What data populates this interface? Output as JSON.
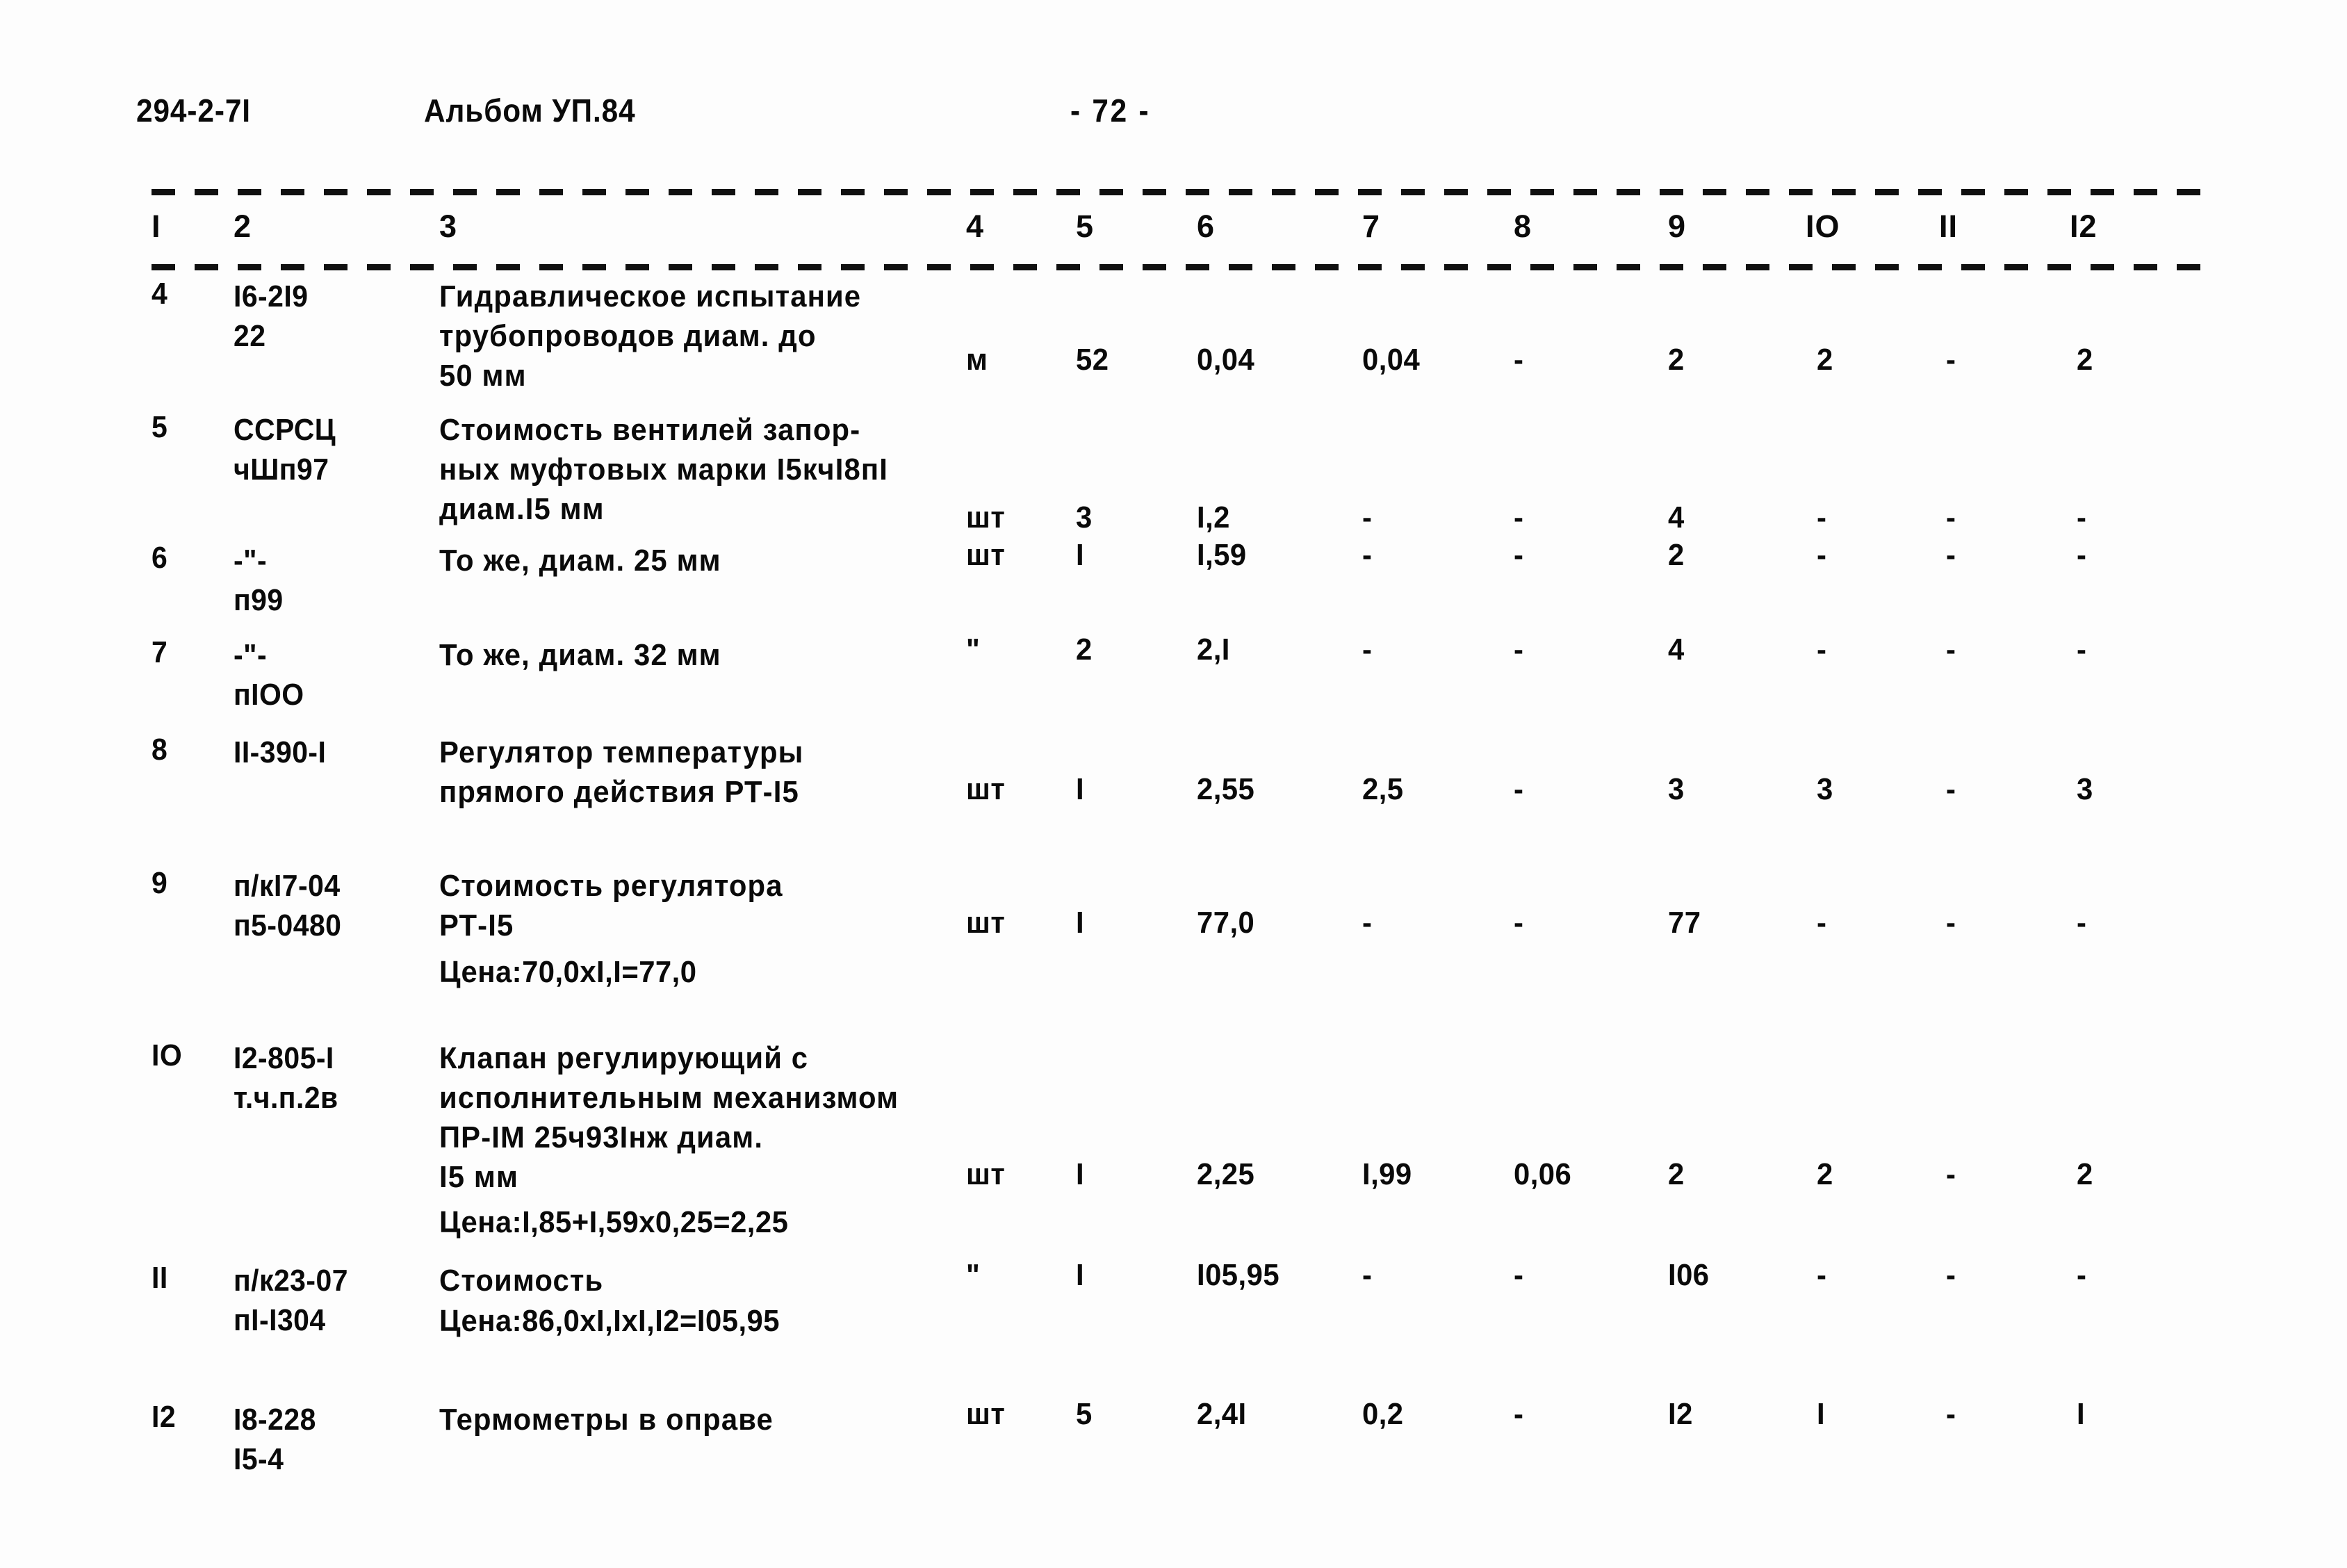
{
  "header": {
    "doc_code": "294-2-7I",
    "album": "Альбом УП.84",
    "page_marker": "- 72 -"
  },
  "table": {
    "column_headers": [
      "I",
      "2",
      "3",
      "4",
      "5",
      "6",
      "7",
      "8",
      "9",
      "IO",
      "II",
      "I2"
    ],
    "rows": [
      {
        "c1": "4",
        "c2": "I6-2I9\n22",
        "c3": "Гидравлическое испытание\nтрубопроводов диам. до\n50 мм",
        "c4": "м",
        "c5": "52",
        "c6": "0,04",
        "c7": "0,04",
        "c8": "-",
        "c9": "2",
        "c10": "2",
        "c11": "-",
        "c12": "2",
        "note": ""
      },
      {
        "c1": "5",
        "c2": "ССРСЦ\nчШп97",
        "c3": "Стоимость вентилей запор-\nных муфтовых марки I5кчI8пI\nдиам.I5 мм",
        "c4": "шт",
        "c5": "3",
        "c6": "I,2",
        "c7": "-",
        "c8": "-",
        "c9": "4",
        "c10": "-",
        "c11": "-",
        "c12": "-",
        "note": ""
      },
      {
        "c1": "6",
        "c2": "-\"-\nп99",
        "c3": "То же, диам. 25 мм",
        "c4": "шт",
        "c5": "I",
        "c6": "I,59",
        "c7": "-",
        "c8": "-",
        "c9": "2",
        "c10": "-",
        "c11": "-",
        "c12": "-",
        "note": ""
      },
      {
        "c1": "7",
        "c2": "-\"-\nпIOO",
        "c3": "То же, диам. 32 мм",
        "c4": "\"",
        "c5": "2",
        "c6": "2,I",
        "c7": "-",
        "c8": "-",
        "c9": "4",
        "c10": "-",
        "c11": "-",
        "c12": "-",
        "note": ""
      },
      {
        "c1": "8",
        "c2": "II-390-I",
        "c3": "Регулятор температуры\nпрямого действия РТ-I5",
        "c4": "шт",
        "c5": "I",
        "c6": "2,55",
        "c7": "2,5",
        "c8": "-",
        "c9": "3",
        "c10": "3",
        "c11": "-",
        "c12": "3",
        "note": ""
      },
      {
        "c1": "9",
        "c2": "п/кI7-04\nп5-0480",
        "c3": "Стоимость регулятора\nРТ-I5",
        "c4": "шт",
        "c5": "I",
        "c6": "77,0",
        "c7": "-",
        "c8": "-",
        "c9": "77",
        "c10": "-",
        "c11": "-",
        "c12": "-",
        "note": "Цена:70,0хI,I=77,0"
      },
      {
        "c1": "IO",
        "c2": "I2-805-I\nт.ч.п.2в",
        "c3": "Клапан регулирующий с\nисполнительным механизмом\nПР-IМ 25ч93Iнж диам.\nI5 мм",
        "c4": "шт",
        "c5": "I",
        "c6": "2,25",
        "c7": "I,99",
        "c8": "0,06",
        "c9": "2",
        "c10": "2",
        "c11": "-",
        "c12": "2",
        "note": "Цена:I,85+I,59х0,25=2,25"
      },
      {
        "c1": "II",
        "c2": "п/к23-07\nпI-I304",
        "c3": "Стоимость",
        "c4": "\"",
        "c5": "I",
        "c6": "I05,95",
        "c7": "-",
        "c8": "-",
        "c9": "I06",
        "c10": "-",
        "c11": "-",
        "c12": "-",
        "note": "Цена:86,0хI,IхI,I2=I05,95"
      },
      {
        "c1": "I2",
        "c2": "I8-228\nI5-4",
        "c3": "Термометры в оправе",
        "c4": "шт",
        "c5": "5",
        "c6": "2,4I",
        "c7": "0,2",
        "c8": "-",
        "c9": "I2",
        "c10": "I",
        "c11": "-",
        "c12": "I",
        "note": ""
      }
    ]
  }
}
